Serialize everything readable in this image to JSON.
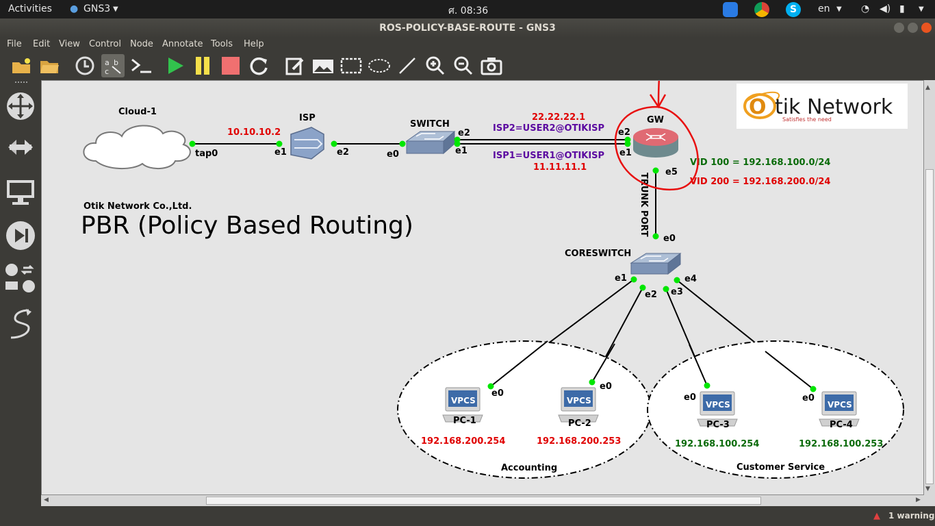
{
  "system": {
    "activities": "Activities",
    "app_menu": "GNS3",
    "clock": "ศ. 08:36",
    "lang": "en"
  },
  "window": {
    "title": "ROS-POLICY-BASE-ROUTE - GNS3"
  },
  "menu": {
    "file": "File",
    "edit": "Edit",
    "view": "View",
    "control": "Control",
    "node": "Node",
    "annotate": "Annotate",
    "tools": "Tools",
    "help": "Help"
  },
  "topology": {
    "nodes": {
      "cloud": "Cloud-1",
      "isp": "ISP",
      "switch": "SWITCH",
      "gw": "GW",
      "coreswitch": "CORESWITCH",
      "pc1": "PC-1",
      "pc2": "PC-2",
      "pc3": "PC-3",
      "pc4": "PC-4",
      "vpcs": "VPCS"
    },
    "ports": {
      "tap0": "tap0",
      "e0": "e0",
      "e1": "e1",
      "e2": "e2",
      "e3": "e3",
      "e4": "e4",
      "e5": "e5"
    },
    "labels": {
      "isp_ip": "10.10.10.2",
      "isp2_ip": "22.22.22.1",
      "isp2": "ISP2=USER2@OTIKISP",
      "isp1": "ISP1=USER1@OTIKISP",
      "isp1_ip": "11.11.11.1",
      "vid100": "VID 100 = 192.168.100.0/24",
      "vid200": "VID 200 = 192.168.200.0/24",
      "trunk": "TRUNK PORT",
      "company": "Otik Network Co.,Ltd.",
      "heading": "PBR (Policy Based Routing)",
      "pc1_ip": "192.168.200.254",
      "pc2_ip": "192.168.200.253",
      "pc3_ip": "192.168.100.254",
      "pc4_ip": "192.168.100.253",
      "accounting": "Accounting",
      "customer_service": "Customer Service"
    },
    "logo": {
      "brand": "tik Network",
      "brand_o": "O",
      "tagline": "Satisfies the need"
    }
  },
  "status": {
    "warning": "1 warning"
  },
  "colors": {
    "link_dot": "#00e600",
    "red_label": "#e00000",
    "purple_label": "#5b0aa0",
    "green_label": "#0a6b0a",
    "annotation_red": "#e81010"
  }
}
